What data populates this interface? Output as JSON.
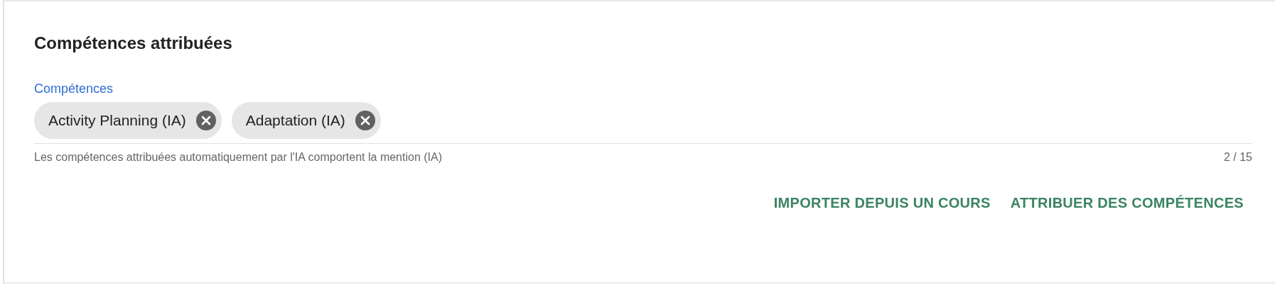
{
  "section": {
    "title": "Compétences attribuées"
  },
  "field": {
    "label": "Compétences",
    "chips": [
      {
        "label": "Activity Planning (IA)"
      },
      {
        "label": "Adaptation (IA)"
      }
    ],
    "helper_text": "Les compétences attribuées automatiquement par l'IA comportent la mention (IA)",
    "counter": "2 / 15"
  },
  "buttons": [
    "IMPORTER DEPUIS UN COURS",
    "ATTRIBUER DES COMPÉTENCES"
  ]
}
